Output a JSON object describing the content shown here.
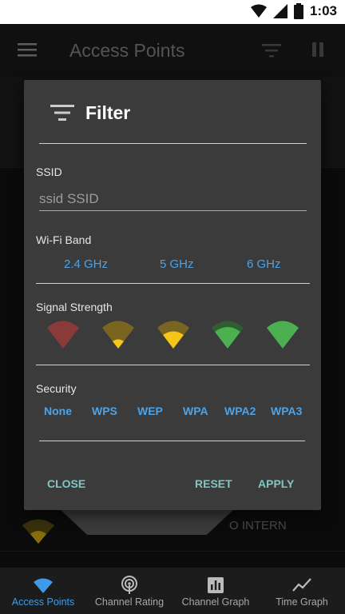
{
  "status_bar": {
    "time": "1:03"
  },
  "app_bar": {
    "title": "Access Points"
  },
  "background": {
    "partial_text": "O INTERN"
  },
  "filter_dialog": {
    "title": "Filter",
    "ssid": {
      "label": "SSID",
      "placeholder": "ssid SSID"
    },
    "wifi_band": {
      "label": "Wi-Fi Band",
      "options": [
        "2.4 GHz",
        "5 GHz",
        "6 GHz"
      ]
    },
    "signal_strength": {
      "label": "Signal Strength",
      "levels": [
        0,
        1,
        2,
        3,
        4
      ]
    },
    "security": {
      "label": "Security",
      "options": [
        "None",
        "WPS",
        "WEP",
        "WPA",
        "WPA2",
        "WPA3"
      ]
    },
    "buttons": {
      "close": "CLOSE",
      "reset": "RESET",
      "apply": "APPLY"
    }
  },
  "bottom_nav": {
    "items": [
      {
        "label": "Access Points",
        "icon": "wifi-icon",
        "active": true
      },
      {
        "label": "Channel Rating",
        "icon": "channel-rating-icon",
        "active": false
      },
      {
        "label": "Channel Graph",
        "icon": "bar-chart-icon",
        "active": false
      },
      {
        "label": "Time Graph",
        "icon": "line-chart-icon",
        "active": false
      }
    ]
  },
  "colors": {
    "accent_blue": "#4da3e8",
    "button_teal": "#7ec7c3",
    "signal_red": "#8b3a3a",
    "signal_yellow": "#f5c518",
    "signal_green": "#4caf50"
  }
}
